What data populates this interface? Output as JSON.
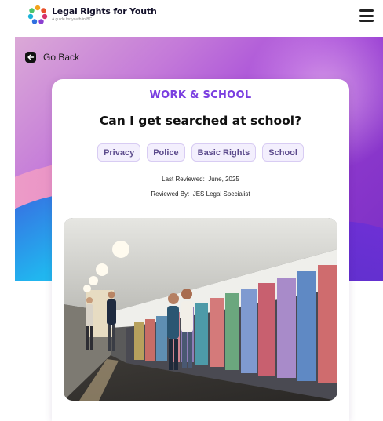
{
  "header": {
    "brand": "Legal Rights for Youth",
    "tagline": "A guide for youth in BC"
  },
  "nav": {
    "back_label": "Go Back"
  },
  "article": {
    "category": "WORK & SCHOOL",
    "title": "Can I get searched at school?",
    "tags": [
      "Privacy",
      "Police",
      "Basic Rights",
      "School"
    ],
    "last_reviewed_label": "Last Reviewed:",
    "last_reviewed_value": "June, 2025",
    "reviewed_by_label": "Reviewed By:",
    "reviewed_by_value": "JES Legal Specialist",
    "image_description": "school-hallway-lockers-photo"
  },
  "colors": {
    "accent": "#7a3ee0",
    "tag_bg": "#f3effd",
    "tag_border": "#d8ccf3",
    "hero_start": "#dba9d7",
    "hero_end": "#7a2fc4"
  },
  "icons": {
    "logo": "ring-of-people-logo",
    "menu": "hamburger-menu-icon",
    "back": "arrow-left-icon"
  }
}
